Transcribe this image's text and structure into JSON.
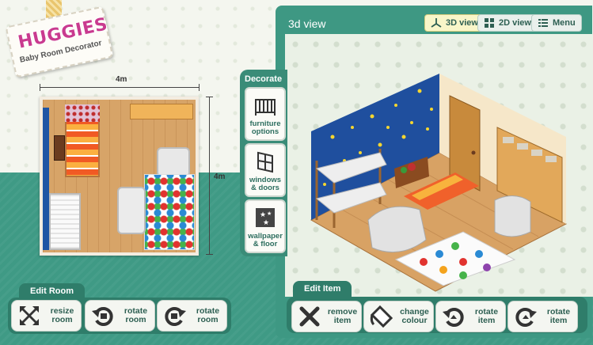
{
  "brand": {
    "name": "HUGGIES",
    "subtitle": "Baby Room Decorator"
  },
  "plan": {
    "width_label": "4m",
    "height_label": "4m"
  },
  "decorate": {
    "title": "Decorate",
    "buttons": [
      {
        "label": "furniture options",
        "icon": "crib-icon"
      },
      {
        "label": "windows & doors",
        "icon": "window-icon"
      },
      {
        "label": "wallpaper & floor",
        "icon": "stars-wallpaper-icon"
      }
    ]
  },
  "view3d": {
    "title": "3d view",
    "buttons": [
      {
        "label": "3D view",
        "icon": "3d-axis-icon",
        "active": true
      },
      {
        "label": "2D view",
        "icon": "grid-icon",
        "active": false
      },
      {
        "label": "Menu",
        "icon": "list-icon",
        "active": false
      }
    ]
  },
  "edit_room": {
    "tab": "Edit Room",
    "buttons": [
      {
        "label": "resize room",
        "icon": "resize-arrows-icon"
      },
      {
        "label": "rotate room",
        "icon": "rotate-ccw-icon"
      },
      {
        "label": "rotate room",
        "icon": "rotate-cw-icon"
      }
    ]
  },
  "edit_item": {
    "tab": "Edit Item",
    "buttons": [
      {
        "label": "remove item",
        "icon": "remove-x-icon"
      },
      {
        "label": "change colour",
        "icon": "paint-bucket-icon"
      },
      {
        "label": "rotate item",
        "icon": "rotate-ccw-icon"
      },
      {
        "label": "rotate item",
        "icon": "rotate-cw-icon"
      }
    ]
  },
  "colors": {
    "panel_green": "#3e9883",
    "dark_green": "#2f7d6a",
    "brand_pink": "#c93a8f",
    "wall_blue": "#1f55a4"
  }
}
